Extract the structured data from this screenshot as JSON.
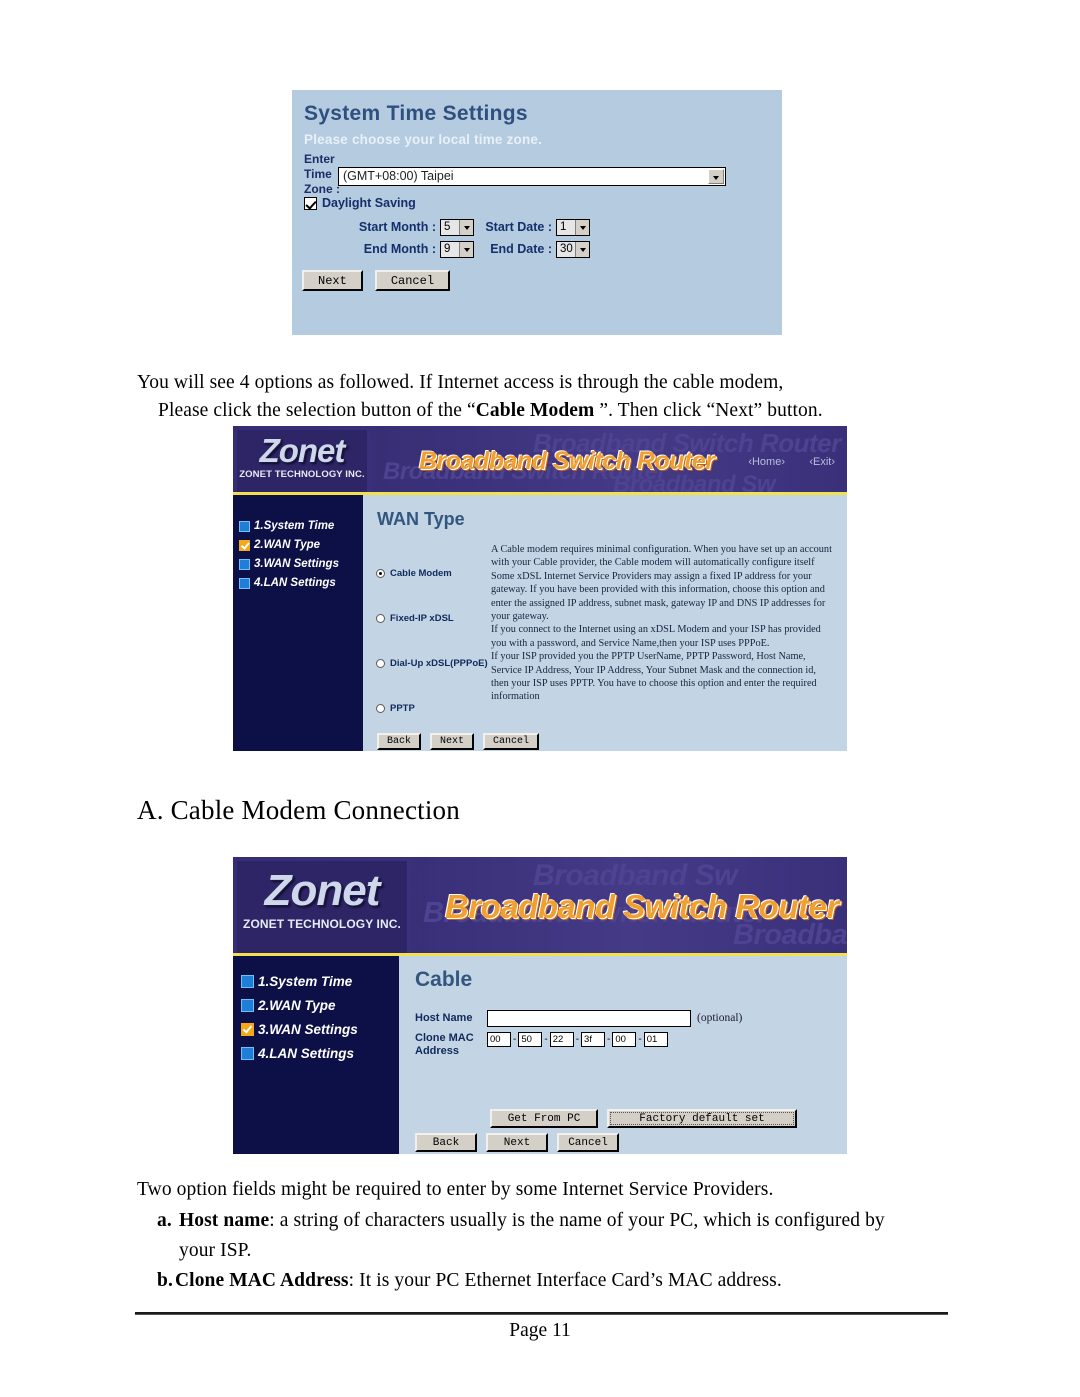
{
  "document": {
    "paragraph_1_line_1": "You will see 4 options as followed. If Internet access is through the cable modem,",
    "paragraph_1_line_2_a": "Please click the selection button of the “",
    "paragraph_1_line_2_bold": "Cable Modem",
    "paragraph_1_line_2_b": " ”. Then click “Next” button.",
    "section_heading": "A. Cable Modem Connection",
    "paragraph_2": "Two option fields might be required to enter by some Internet Service Providers.",
    "bullet_a_marker": "a.",
    "bullet_a_bold": "Host name",
    "bullet_a_text": ": a string of characters usually is the name of your PC, which is configured by",
    "bullet_a_text_line2": "your ISP.",
    "bullet_b_marker": "b.",
    "bullet_b_bold": "Clone MAC Address",
    "bullet_b_text": ":    It is your PC Ethernet Interface Card’s MAC address.",
    "page_number": "Page 11"
  },
  "system_time_screen": {
    "title": "System Time Settings",
    "subtitle": "Please choose your local time zone.",
    "timezone_label": "Enter Time Zone :",
    "timezone_value": "(GMT+08:00) Taipei",
    "daylight_saving_label": "Daylight Saving",
    "daylight_saving_checked": true,
    "start_month_label": "Start Month :",
    "start_month_value": "5",
    "start_date_label": "Start Date :",
    "start_date_value": "1",
    "end_month_label": "End Month :",
    "end_month_value": "9",
    "end_date_label": "End Date :",
    "end_date_value": "30",
    "next_label": "Next",
    "cancel_label": "Cancel"
  },
  "brand": {
    "logo_text": "Zonet",
    "logo_subtext": "ZONET TECHNOLOGY INC.",
    "banner_title": "Broadband Switch Router",
    "ghost_text": "Broadband Switch Router",
    "ghost_text_short": "Broadband Sw",
    "home_link": "‹Home›",
    "exit_link": "‹Exit›",
    "accent_yellow": "#f2e14c",
    "header_purple": "#3b317a",
    "sidebar_navy": "#0d1047",
    "panel_blue": "#c3d4e4",
    "check_orange": "#f4a81c",
    "title_blue": "#33567f"
  },
  "wan_type_screen": {
    "page_title": "WAN Type",
    "sidebar": [
      {
        "label": "1.System Time",
        "checked": false
      },
      {
        "label": "2.WAN Type",
        "checked": true
      },
      {
        "label": "3.WAN Settings",
        "checked": false
      },
      {
        "label": "4.LAN Settings",
        "checked": false
      }
    ],
    "options": [
      {
        "label": "Cable Modem",
        "selected": true
      },
      {
        "label": "Fixed-IP xDSL",
        "selected": false
      },
      {
        "label": "Dial-Up xDSL(PPPoE)",
        "selected": false
      },
      {
        "label": "PPTP",
        "selected": false
      }
    ],
    "descriptions": [
      "A Cable modem requires minimal configuration. When you have set up an account with your Cable provider, the Cable modem will automatically configure itself",
      "Some xDSL Internet Service Providers may assign a fixed IP address for your gateway. If you have been provided with this information, choose this option and enter the assigned IP address, subnet mask, gateway IP and DNS IP addresses for your gateway.",
      "If you connect to the Internet using an xDSL Modem and your ISP has provided you with a password, and Service Name,then your ISP uses PPPoE.",
      "If your ISP provided you the PPTP UserName, PPTP Password, Host Name, Service IP Address, Your IP Address, Your Subnet Mask and the connection id, then your ISP uses PPTP. You have to choose this option and enter the required information"
    ],
    "back_label": "Back",
    "next_label": "Next",
    "cancel_label": "Cancel"
  },
  "cable_screen": {
    "page_title": "Cable",
    "sidebar": [
      {
        "label": "1.System Time",
        "checked": false
      },
      {
        "label": "2.WAN Type",
        "checked": false
      },
      {
        "label": "3.WAN Settings",
        "checked": true
      },
      {
        "label": "4.LAN Settings",
        "checked": false
      }
    ],
    "host_name_label": "Host Name",
    "host_name_value": "",
    "host_name_note": "(optional)",
    "clone_mac_label": "Clone MAC Address",
    "clone_mac_octets": [
      "00",
      "50",
      "22",
      "3f",
      "00",
      "01"
    ],
    "get_from_pc_label": "Get From PC",
    "factory_default_label": "Factory default set",
    "back_label": "Back",
    "next_label": "Next",
    "cancel_label": "Cancel"
  }
}
